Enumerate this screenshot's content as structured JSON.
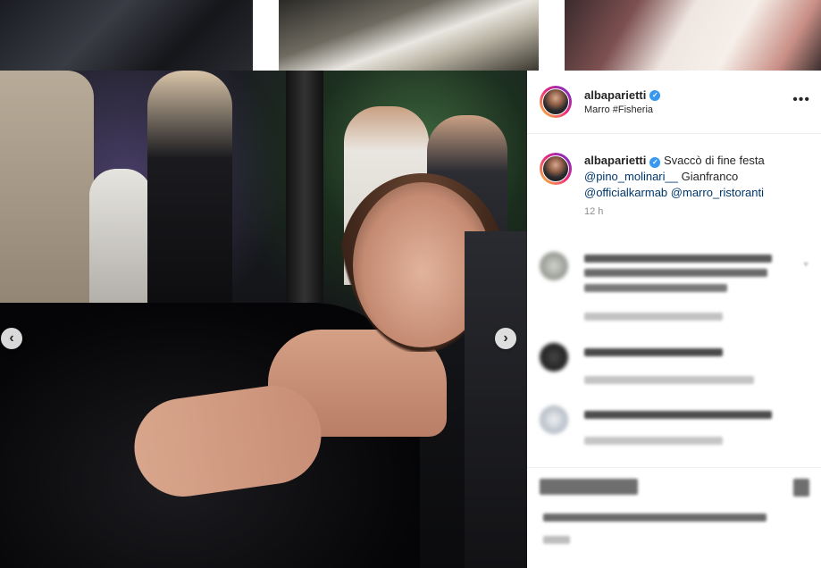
{
  "post": {
    "username": "albaparietti",
    "location": "Marro #Fisheria",
    "caption_prefix": "Svaccò di fine festa",
    "mention1": "@pino_molinari__",
    "caption_mid": "Gianfranco",
    "mention2": "@officialkarmab",
    "mention3": "@marro_ristoranti",
    "time": "12 h"
  },
  "icons": {
    "verified": "verified-badge-icon",
    "more": "more-options-icon",
    "prev": "chevron-left-icon",
    "next": "chevron-right-icon"
  },
  "glyphs": {
    "verified": "✓",
    "more": "•••",
    "prev": "‹",
    "next": "›"
  },
  "colors": {
    "accent": "#3897f0",
    "mention": "#00376b",
    "muted": "#8e8e8e"
  }
}
